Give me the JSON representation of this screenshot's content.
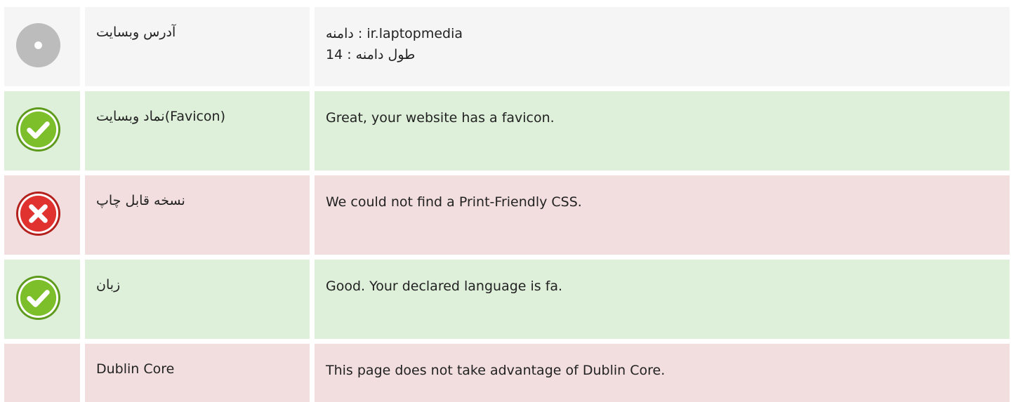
{
  "rows": [
    {
      "status": "neutral",
      "icon": "info-circle-icon",
      "label": "آدرس وبسایت",
      "value_lines": [
        "دامنه : ir.laptopmedia",
        "طول دامنه : 14"
      ]
    },
    {
      "status": "ok",
      "icon": "check-circle-icon",
      "label": "نماد وبسایت(Favicon)",
      "value_lines": [
        "Great, your website has a favicon."
      ]
    },
    {
      "status": "bad",
      "icon": "error-circle-icon",
      "label": "نسخه قابل چاپ",
      "value_lines": [
        "We could not find a Print-Friendly CSS."
      ]
    },
    {
      "status": "ok",
      "icon": "check-circle-icon",
      "label": "زبان",
      "value_lines": [
        "Good. Your declared language is fa."
      ]
    },
    {
      "status": "bad",
      "icon": "",
      "label": "Dublin Core",
      "value_lines": [
        "This page does not take advantage of Dublin Core."
      ]
    }
  ],
  "colors": {
    "neutral_bg": "#f5f5f5",
    "ok_bg": "#def0da",
    "bad_bg": "#f2dedf",
    "ok_icon": "#7cbf2a",
    "bad_icon": "#e0332f",
    "neutral_icon": "#bcbcbc"
  }
}
